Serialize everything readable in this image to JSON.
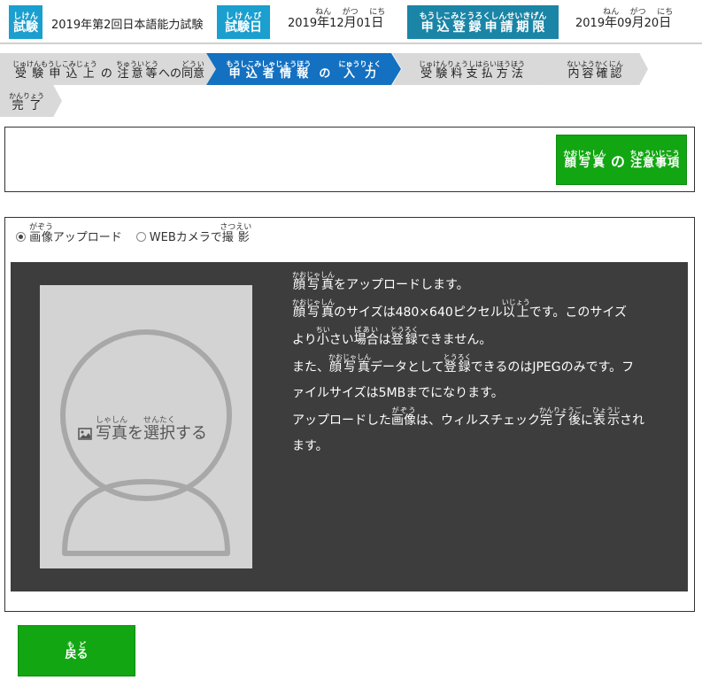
{
  "header": {
    "exam_tag": {
      "text": "試験",
      "ruby": "しけん"
    },
    "exam_name": "2019年第2回日本語能力試験",
    "exam_date_tag": {
      "text": "試験日",
      "ruby": "しけんび"
    },
    "exam_date": {
      "year": "2019",
      "year_unit": "年",
      "year_ruby": "ねん",
      "month": "12",
      "month_unit": "月",
      "month_ruby": "がつ",
      "day": "01",
      "day_unit": "日",
      "day_ruby": "にち"
    },
    "deadline_tag": {
      "text": "申込登録申請期限",
      "ruby": "もうしこみとうろくしんせいきげん"
    },
    "deadline_date": {
      "year": "2019",
      "year_unit": "年",
      "year_ruby": "ねん",
      "month": "09",
      "month_unit": "月",
      "month_ruby": "がつ",
      "day": "20",
      "day_unit": "日",
      "day_ruby": "にち"
    }
  },
  "steps": [
    {
      "rb1": "受験申込上",
      "rt1": "じゅけんもうしこみじょう",
      "mid": "の",
      "rb2": "注意等",
      "rt2": "ちゅういとう",
      "mid2": "への",
      "rb3": "同意",
      "rt3": "どうい",
      "active": false
    },
    {
      "rb1": "申込者情報",
      "rt1": "もうしこみしゃじょうほう",
      "mid": "の",
      "rb2": "入力",
      "rt2": "にゅうりょく",
      "active": true
    },
    {
      "rb1": "受験料支払方法",
      "rt1": "じゅけんりょうしはらいほうほう",
      "active": false
    },
    {
      "rb1": "内容確認",
      "rt1": "ないようかくにん",
      "active": false
    },
    {
      "rb1": "完了",
      "rt1": "かんりょう",
      "active": false
    }
  ],
  "notice_button": {
    "rb1": "顔写真",
    "rt1": "かおじゃしん",
    "mid": "の",
    "rb2": "注意事項",
    "rt2": "ちゅういじこう"
  },
  "upload_mode": {
    "options": [
      {
        "rb": "画像",
        "rt": "がぞう",
        "suffix": "アップロード",
        "selected": true
      },
      {
        "prefix": "WEBカメラで",
        "rb": "撮影",
        "rt": "さつえい",
        "selected": false
      }
    ]
  },
  "photo_select": {
    "rb1": "写真",
    "rt1": "しゃしん",
    "mid": "を",
    "rb2": "選択",
    "rt2": "せんたく",
    "suffix": "する"
  },
  "instructions": {
    "l1": {
      "rb": "顔写真",
      "rt": "かおじゃしん",
      "after": "をアップロードします。"
    },
    "l2": {
      "rb": "顔写真",
      "rt": "かおじゃしん",
      "mid": "のサイズは480×640ピクセル",
      "rb2": "以上",
      "rt2": "いじょう",
      "after": "です。このサイズ"
    },
    "l3": {
      "before": "より",
      "rb": "小",
      "rt": "ちい",
      "mid": "さい",
      "rb2": "場合",
      "rt2": "ばあい",
      "mid2": "は",
      "rb3": "登録",
      "rt3": "とうろく",
      "after": "できません。"
    },
    "l4": {
      "before": "また、",
      "rb": "顔写真",
      "rt": "かおじゃしん",
      "mid": "データとして",
      "rb2": "登録",
      "rt2": "とうろく",
      "after": "できるのはJPEGのみです。フ"
    },
    "l5": {
      "text": "ァイルサイズは5MBまでになります。"
    },
    "l6": {
      "before": "アップロードした",
      "rb": "画像",
      "rt": "がぞう",
      "mid": "は、ウィルスチェック",
      "rb2": "完了後",
      "rt2": "かんりょうご",
      "mid2": "に",
      "rb3": "表示",
      "rt3": "ひょうじ",
      "after": "され"
    },
    "l7": {
      "text": "ます。"
    }
  },
  "back_button": {
    "rb": "戻る",
    "rt": "もど"
  },
  "colors": {
    "accent_blue": "#1a9fcf",
    "active_step": "#1470c0",
    "green": "#12a612",
    "panel": "#3d3d3d"
  }
}
